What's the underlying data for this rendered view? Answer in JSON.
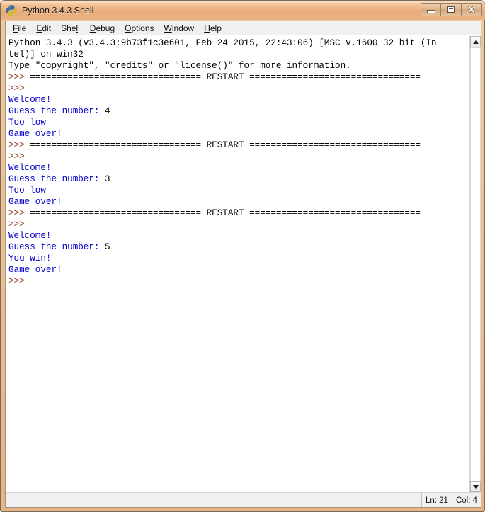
{
  "window": {
    "title": "Python 3.4.3 Shell",
    "icon": "python-logo-icon",
    "controls": {
      "minimize_label": "–",
      "maximize_label": "□",
      "close_label": "✕"
    }
  },
  "menubar": {
    "items": [
      {
        "name": "file",
        "accel": "F",
        "rest": "ile"
      },
      {
        "name": "edit",
        "accel": "E",
        "rest": "dit"
      },
      {
        "name": "shell",
        "accel": "S",
        "rest": "hell",
        "pre": "",
        "underline_index": 3
      },
      {
        "name": "debug",
        "accel": "D",
        "rest": "ebug"
      },
      {
        "name": "options",
        "accel": "O",
        "rest": "ptions"
      },
      {
        "name": "window",
        "accel": "W",
        "rest": "indow"
      },
      {
        "name": "help",
        "accel": "H",
        "rest": "elp"
      }
    ],
    "labels": [
      "File",
      "Edit",
      "Shell",
      "Debug",
      "Options",
      "Window",
      "Help"
    ]
  },
  "console": {
    "lines": [
      [
        {
          "text": "Python 3.4.3 (v3.4.3:9b73f1c3e601, Feb 24 2015, 22:43:06) [MSC v.1600 32 bit (In",
          "color": "black"
        }
      ],
      [
        {
          "text": "tel)] on win32",
          "color": "black"
        }
      ],
      [
        {
          "text": "Type \"copyright\", \"credits\" or \"license()\" for more information.",
          "color": "black"
        }
      ],
      [
        {
          "text": ">>> ",
          "color": "prompt"
        },
        {
          "text": "================================ RESTART ================================",
          "color": "black"
        }
      ],
      [
        {
          "text": ">>> ",
          "color": "prompt"
        }
      ],
      [
        {
          "text": "Welcome!",
          "color": "blue"
        }
      ],
      [
        {
          "text": "Guess the number: ",
          "color": "blue"
        },
        {
          "text": "4",
          "color": "black"
        }
      ],
      [
        {
          "text": "Too low",
          "color": "blue"
        }
      ],
      [
        {
          "text": "Game over!",
          "color": "blue"
        }
      ],
      [
        {
          "text": ">>> ",
          "color": "prompt"
        },
        {
          "text": "================================ RESTART ================================",
          "color": "black"
        }
      ],
      [
        {
          "text": ">>> ",
          "color": "prompt"
        }
      ],
      [
        {
          "text": "Welcome!",
          "color": "blue"
        }
      ],
      [
        {
          "text": "Guess the number: ",
          "color": "blue"
        },
        {
          "text": "3",
          "color": "black"
        }
      ],
      [
        {
          "text": "Too low",
          "color": "blue"
        }
      ],
      [
        {
          "text": "Game over!",
          "color": "blue"
        }
      ],
      [
        {
          "text": ">>> ",
          "color": "prompt"
        },
        {
          "text": "================================ RESTART ================================",
          "color": "black"
        }
      ],
      [
        {
          "text": ">>> ",
          "color": "prompt"
        }
      ],
      [
        {
          "text": "Welcome!",
          "color": "blue"
        }
      ],
      [
        {
          "text": "Guess the number: ",
          "color": "blue"
        },
        {
          "text": "5",
          "color": "black"
        }
      ],
      [
        {
          "text": "You win!",
          "color": "blue"
        }
      ],
      [
        {
          "text": "Game over!",
          "color": "blue"
        }
      ],
      [
        {
          "text": ">>> ",
          "color": "prompt"
        }
      ]
    ]
  },
  "statusbar": {
    "line_label": "Ln: 21",
    "col_label": "Col: 4"
  },
  "colors": {
    "output_blue": "#0000cc",
    "prompt_brown": "#8b3a1a",
    "stdout_black": "#000000",
    "titlebar_orange": "#e8ab79",
    "frame_brown": "#7a6a58"
  }
}
